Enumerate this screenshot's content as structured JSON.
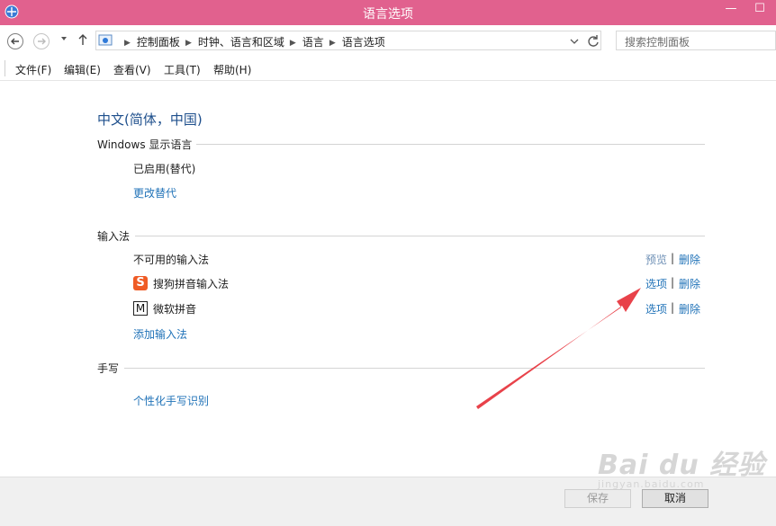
{
  "window": {
    "title": "语言选项",
    "minimize_glyph": "—",
    "maximize_glyph": "☐"
  },
  "address_bar": {
    "breadcrumbs": [
      "控制面板",
      "时钟、语言和区域",
      "语言",
      "语言选项"
    ],
    "search_placeholder": "搜索控制面板"
  },
  "menu": [
    "文件(F)",
    "编辑(E)",
    "查看(V)",
    "工具(T)",
    "帮助(H)"
  ],
  "language": {
    "title": "中文(简体，中国)",
    "display_language": {
      "section": "Windows 显示语言",
      "status": "已启用(替代)",
      "change_link": "更改替代"
    },
    "input_methods": {
      "section": "输入法",
      "items": [
        {
          "name": "不可用的输入法",
          "action": "预览",
          "remove": "删除"
        },
        {
          "name": "搜狗拼音输入法",
          "icon_letter": "S",
          "icon": "sogou-icon",
          "action": "选项",
          "remove": "删除"
        },
        {
          "name": "微软拼音",
          "icon_letter": "M",
          "icon": "microsoft-pinyin-icon",
          "action": "选项",
          "remove": "删除"
        }
      ],
      "add_link": "添加输入法",
      "separator": "|"
    },
    "handwriting": {
      "section": "手写",
      "link": "个性化手写识别"
    }
  },
  "footer": {
    "save": "保存",
    "cancel": "取消"
  },
  "watermark": {
    "main": "Bai du 经验",
    "sub": "jingyan.baidu.com"
  },
  "colors": {
    "titlebar": "#e1618e",
    "link": "#2173b8",
    "heading": "#1e4f8c",
    "arrow": "#e8424a"
  }
}
